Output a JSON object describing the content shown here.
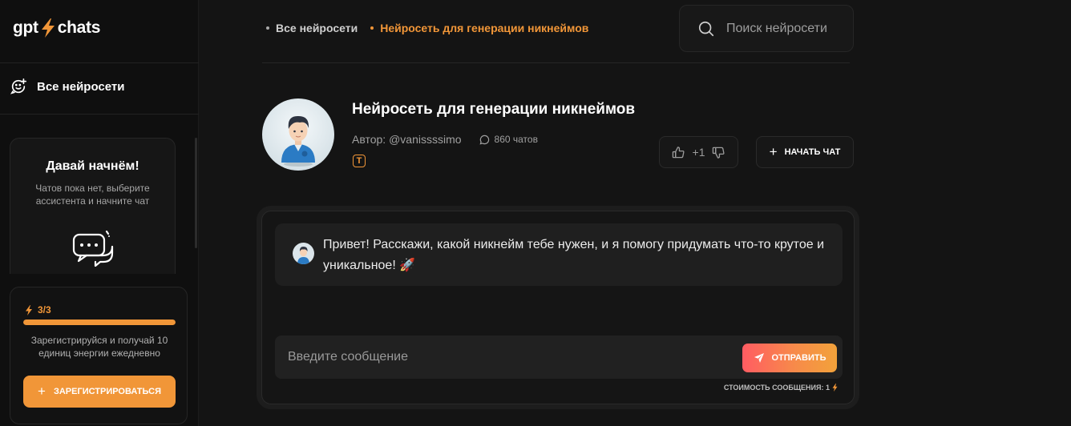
{
  "app": {
    "logo_left": "gpt",
    "logo_right": "chats"
  },
  "sidebar": {
    "nav_label": "Все нейросети",
    "start_card": {
      "title": "Давай начнём!",
      "text": "Чатов пока нет, выберите ассистента и начните чат"
    },
    "energy": {
      "count": "3/3",
      "fraction": 1.0,
      "text": "Зарегистрируйся и получай 10 единиц энергии ежедневно",
      "register_label": "ЗАРЕГИСТРИРОВАТЬСЯ"
    }
  },
  "breadcrumb": [
    {
      "label": "Все нейросети"
    },
    {
      "label": "Нейросеть для генерации никнеймов"
    }
  ],
  "search": {
    "placeholder": "Поиск нейросети"
  },
  "assistant": {
    "title": "Нейросеть для генерации никнеймов",
    "author": "Автор: @vanissssimo",
    "chats": "860 чатов",
    "badge": "T",
    "votes": "+1",
    "start_chat_label": "НАЧАТЬ ЧАТ"
  },
  "chat": {
    "greeting": "Привет! Расскажи, какой никнейм тебе нужен, и я помогу придумать что-то крутое и уникальное! 🚀",
    "input_placeholder": "Введите сообщение",
    "send_label": "ОТПРАВИТЬ",
    "cost_label": "СТОИМОСТЬ СООБЩЕНИЯ: 1"
  },
  "colors": {
    "accent": "#f19638",
    "background": "#141414",
    "sidebar": "#0f0f0f"
  },
  "icons": [
    "bolt-icon",
    "chat-plus-icon",
    "chat-bubbles-icon",
    "search-icon",
    "comment-icon",
    "thumbs-up-icon",
    "thumbs-down-icon",
    "plus-icon",
    "send-icon"
  ]
}
